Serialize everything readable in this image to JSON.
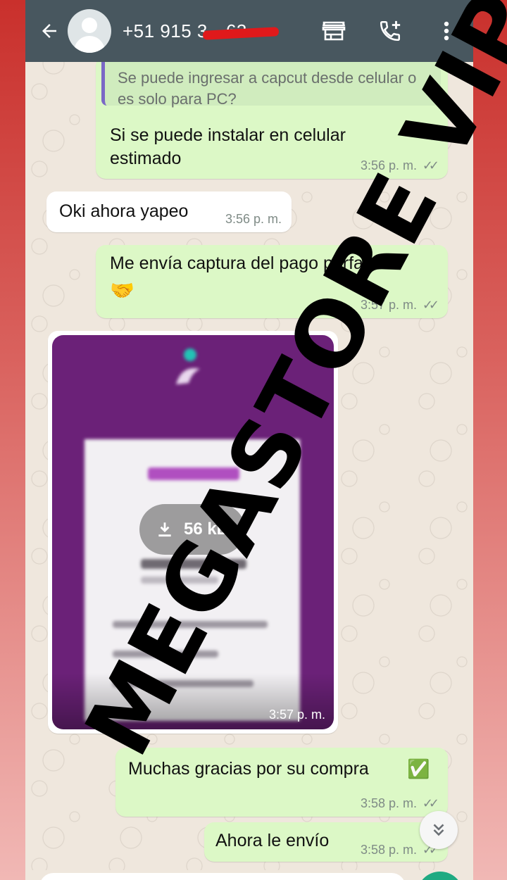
{
  "header": {
    "contact_title": "+51 915 3",
    "contact_title_tail": "63",
    "back_icon": "arrow-left-icon",
    "icons": [
      "store-icon",
      "add-call-icon",
      "more-vert-icon"
    ]
  },
  "messages": [
    {
      "quoted_text": "Se puede ingresar a capcut desde celular o es solo para PC?",
      "text_line1": "Si se puede instalar en celular",
      "text_line2": "estimado",
      "time": "3:56 p. m."
    },
    {
      "text": "Oki ahora yapeo",
      "time": "3:56 p. m."
    },
    {
      "text_line1": "Me envía captura del pago porfavor",
      "emoji": "🤝",
      "time": "3:57 p. m."
    },
    {
      "image_size": "56 kB",
      "time": "3:57 p. m."
    },
    {
      "text": "Muchas gracias por su compra",
      "emoji": "✅",
      "time": "3:58 p. m."
    },
    {
      "text": "Ahora le envío",
      "time": "3:58 p. m."
    }
  ],
  "watermark": "MEGASTORE VIP",
  "colors": {
    "header": "#48575f",
    "outgoing_bubble": "#dcf8c6",
    "incoming_bubble": "#ffffff",
    "chat_bg": "#efe7dd",
    "image_bg": "#6b2178",
    "fab": "#1faa82"
  }
}
